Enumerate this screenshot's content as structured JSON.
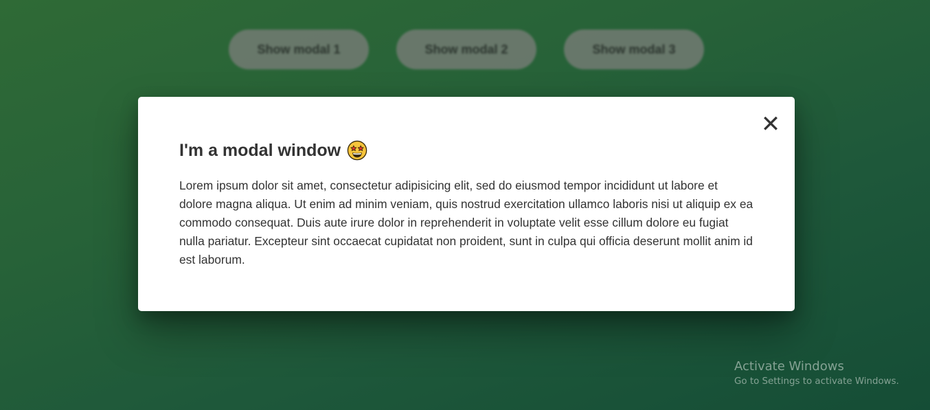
{
  "buttons": {
    "modal1": "Show modal 1",
    "modal2": "Show modal 2",
    "modal3": "Show modal 3"
  },
  "modal": {
    "close_symbol": "✕",
    "title": "I'm a modal window",
    "title_emoji": "star-struck-emoji",
    "body": "Lorem ipsum dolor sit amet, consectetur adipisicing elit, sed do eiusmod tempor incididunt ut labore et dolore magna aliqua. Ut enim ad minim veniam, quis nostrud exercitation ullamco laboris nisi ut aliquip ex ea commodo consequat. Duis aute irure dolor in reprehenderit in voluptate velit esse cillum dolore eu fugiat nulla pariatur. Excepteur sint occaecat cupidatat non proident, sunt in culpa qui officia deserunt mollit anim id est laborum."
  },
  "watermark": {
    "title": "Activate Windows",
    "subtitle": "Go to Settings to activate Windows."
  },
  "colors": {
    "background_start": "#2f6a36",
    "background_end": "#154d36",
    "button_bg": "#6f7a70",
    "modal_bg": "#ffffff",
    "text": "#333333"
  }
}
